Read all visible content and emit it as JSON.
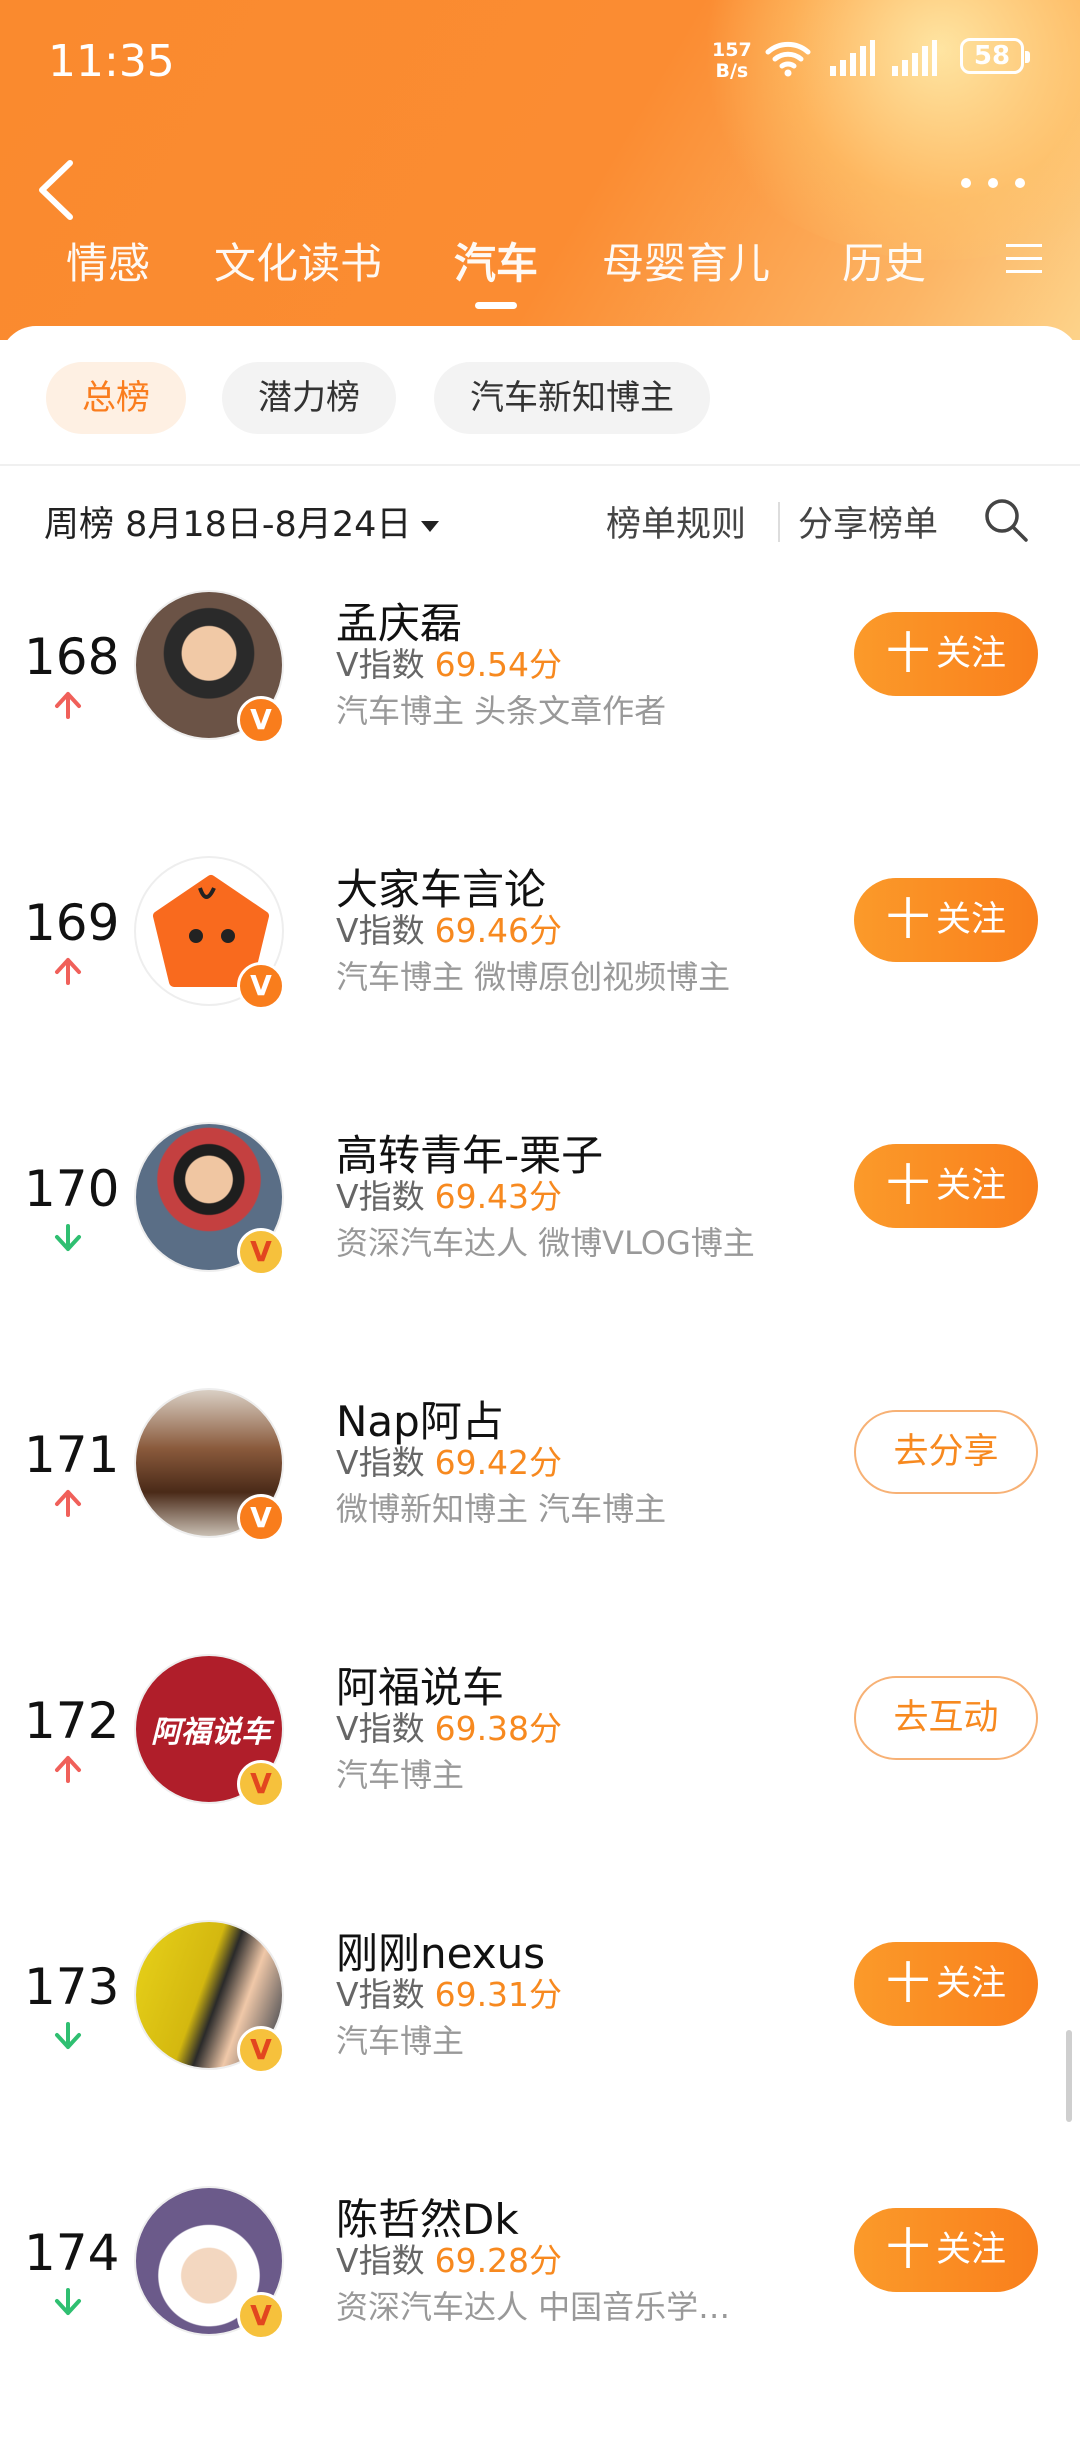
{
  "status": {
    "time": "11:35",
    "net_speed_top": "157",
    "net_speed_bottom": "B/s",
    "battery": "58"
  },
  "tabs": [
    {
      "label": "情感"
    },
    {
      "label": "文化读书"
    },
    {
      "label": "汽车"
    },
    {
      "label": "母婴育儿"
    },
    {
      "label": "历史"
    }
  ],
  "pills": [
    {
      "label": "总榜"
    },
    {
      "label": "潜力榜"
    },
    {
      "label": "汽车新知博主"
    }
  ],
  "filter": {
    "period": "周榜 8月18日-8月24日",
    "rules": "榜单规则",
    "share": "分享榜单"
  },
  "colors": {
    "accent": "#f97f1c",
    "up": "#f0605a",
    "down": "#2fbf71"
  },
  "rows": [
    {
      "rank": "168",
      "trend": "up",
      "name": "孟庆磊",
      "vlabel": "V指数",
      "score": "69.54分",
      "tags": "汽车博主 头条文章作者",
      "badge": "orange",
      "button": "关注",
      "button_plus": "十",
      "button_style": "fill"
    },
    {
      "rank": "169",
      "trend": "up",
      "name": "大家车言论",
      "vlabel": "V指数",
      "score": "69.46分",
      "tags": "汽车博主 微博原创视频博主",
      "badge": "orange",
      "button": "关注",
      "button_plus": "十",
      "button_style": "fill"
    },
    {
      "rank": "170",
      "trend": "down",
      "name": "高转青年-栗子",
      "vlabel": "V指数",
      "score": "69.43分",
      "tags": "资深汽车达人 微博VLOG博主",
      "badge": "gold",
      "button": "关注",
      "button_plus": "十",
      "button_style": "fill"
    },
    {
      "rank": "171",
      "trend": "up",
      "name": "Nap阿占",
      "vlabel": "V指数",
      "score": "69.42分",
      "tags": "微博新知博主 汽车博主",
      "badge": "orange",
      "button": "去分享",
      "button_plus": "",
      "button_style": "outline"
    },
    {
      "rank": "172",
      "trend": "up",
      "name": "阿福说车",
      "vlabel": "V指数",
      "score": "69.38分",
      "tags": "汽车博主",
      "badge": "gold",
      "button": "去互动",
      "button_plus": "",
      "button_style": "outline"
    },
    {
      "rank": "173",
      "trend": "down",
      "name": "刚刚nexus",
      "vlabel": "V指数",
      "score": "69.31分",
      "tags": "汽车博主",
      "badge": "gold",
      "button": "关注",
      "button_plus": "十",
      "button_style": "fill"
    },
    {
      "rank": "174",
      "trend": "down",
      "name": "陈哲然Dk",
      "vlabel": "V指数",
      "score": "69.28分",
      "tags": "资深汽车达人 中国音乐学…",
      "badge": "gold",
      "button": "关注",
      "button_plus": "十",
      "button_style": "fill"
    }
  ],
  "avatar_logo_text": "阿福说车"
}
